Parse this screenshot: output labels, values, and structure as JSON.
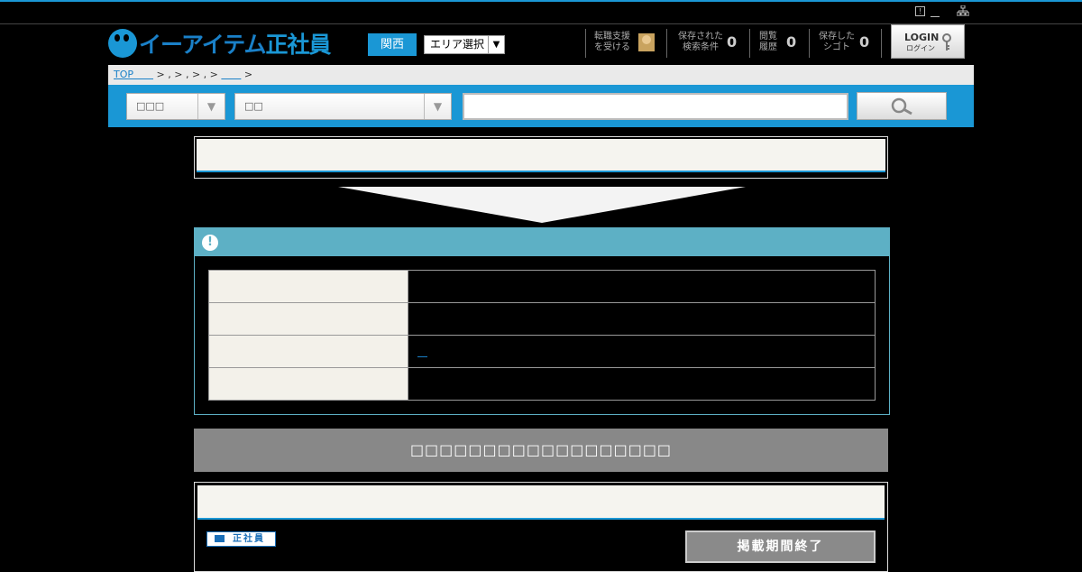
{
  "utility": {
    "link1": "　",
    "sitemap_icon": "sitemap-icon"
  },
  "header": {
    "logo_part1": "イーアイテム",
    "logo_part2": "正社員",
    "area_button": "関西",
    "area_select": "エリア選択",
    "support_label_1": "転職支援",
    "support_label_2": "を受ける",
    "saved_conditions_label_1": "保存された",
    "saved_conditions_label_2": "検索条件",
    "saved_conditions_count": "0",
    "history_label_1": "閲覧",
    "history_label_2": "履歴",
    "history_count": "0",
    "saved_jobs_label_1": "保存した",
    "saved_jobs_label_2": "シゴト",
    "saved_jobs_count": "0",
    "login_label": "LOGIN",
    "login_sub": "ログイン"
  },
  "breadcrumb": {
    "top": "TOP　　",
    "sep1": " > ",
    "sep2": ", > ",
    "sep3": ", > ",
    "sep4": ", > ",
    "last": "　　",
    "end": " >"
  },
  "search": {
    "select1": "□□□",
    "select2": "□□",
    "input_value": ""
  },
  "notice": {
    "link": "　"
  },
  "graybar": {
    "text": "□□□□□□□□□□□□□□□□□□"
  },
  "job": {
    "badge": "正社員",
    "expired": "掲載期間終了"
  },
  "colors": {
    "accent": "#1a97d5",
    "notice_head": "#5db0c5",
    "gray_bar": "#888888"
  }
}
